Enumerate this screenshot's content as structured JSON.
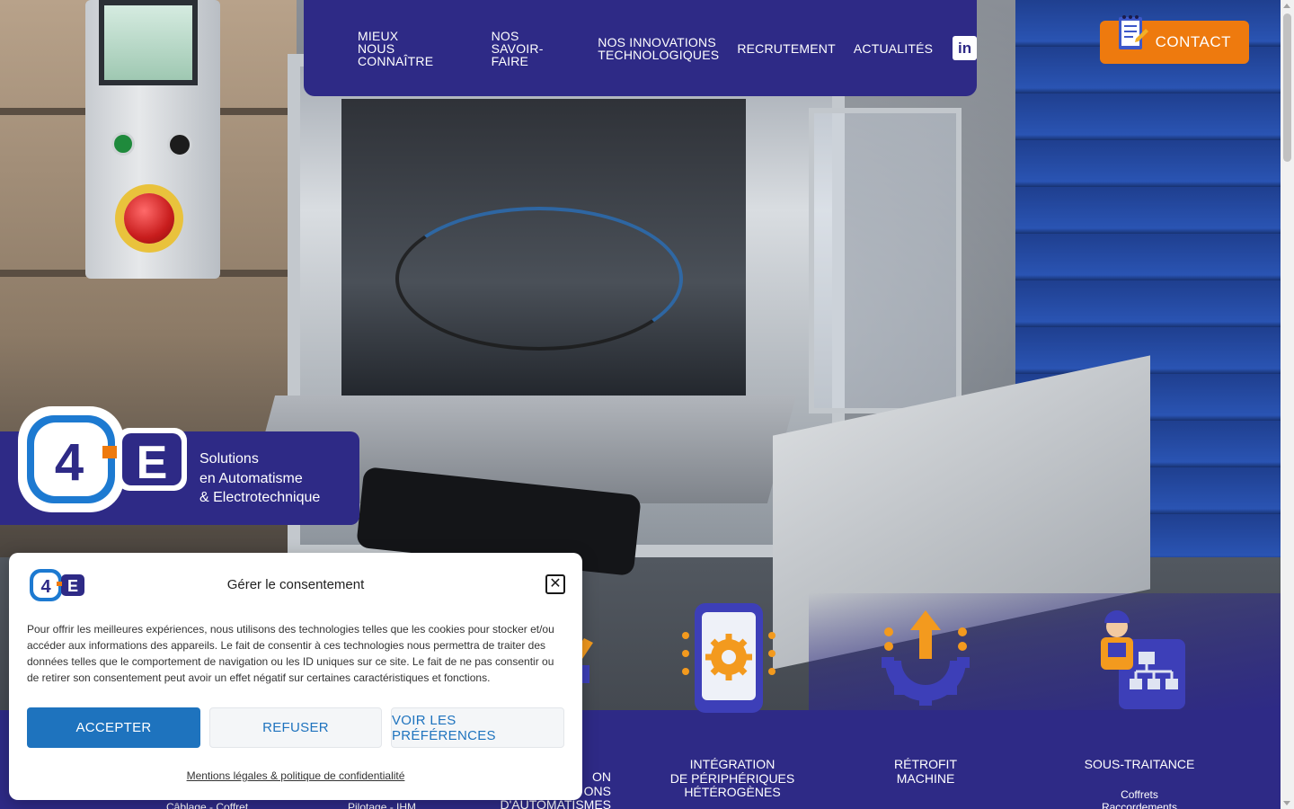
{
  "nav": {
    "items": [
      {
        "line1": "MIEUX",
        "line2": "NOUS CONNAÎTRE"
      },
      {
        "line1": "NOS",
        "line2": "SAVOIR-FAIRE"
      },
      {
        "line1": "NOS INNOVATIONS",
        "line2": "TECHNOLOGIQUES"
      },
      {
        "line1": "RECRUTEMENT",
        "line2": ""
      },
      {
        "line1": "ACTUALITÉS",
        "line2": ""
      }
    ],
    "linkedin_icon": "linkedin-icon",
    "linkedin_glyph": "in"
  },
  "contact": {
    "label": "CONTACT",
    "icon": "notepad-pencil-icon"
  },
  "brand": {
    "logo_text": "C4E",
    "tagline": [
      "Solutions",
      "en Automatisme",
      "& Electrotechnique"
    ],
    "primary_color": "#2e2a86",
    "accent_color": "#ee7a0e"
  },
  "services": [
    {
      "title": [
        "ON",
        "ONS",
        "D'AUTOMATISMES"
      ],
      "sub": []
    },
    {
      "title": [
        "INTÉGRATION",
        "DE PÉRIPHÉRIQUES",
        "HÉTÉROGÈNES"
      ],
      "sub": [],
      "icon": "smartphone-gear-icon"
    },
    {
      "title": [
        "RÉTROFIT",
        "MACHINE"
      ],
      "sub": [],
      "icon": "gear-upload-icon"
    },
    {
      "title": [
        "SOUS-TRAITANCE"
      ],
      "sub": [
        "Coffrets",
        "Raccordements"
      ],
      "icon": "worker-schema-icon"
    }
  ],
  "partial_subs": {
    "left": "Câblage - Coffret",
    "middle": "Pilotage - IHM"
  },
  "consent": {
    "title": "Gérer le consentement",
    "close_glyph": "✕",
    "text": "Pour offrir les meilleures expériences, nous utilisons des technologies telles que les cookies pour stocker et/ou accéder aux informations des appareils. Le fait de consentir à ces technologies nous permettra de traiter des données telles que le comportement de navigation ou les ID uniques sur ce site. Le fait de ne pas consentir ou de retirer son consentement peut avoir un effet négatif sur certaines caractéristiques et fonctions.",
    "accept": "ACCEPTER",
    "refuse": "REFUSER",
    "preferences": "VOIR LES PRÉFÉRENCES",
    "legal_link": "Mentions légales & politique de confidentialité",
    "accept_color": "#1e73be"
  }
}
